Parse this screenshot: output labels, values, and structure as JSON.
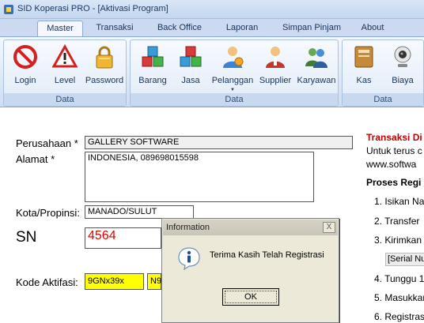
{
  "window": {
    "title": "SID Koperasi PRO - [Aktivasi Program]"
  },
  "tabs": [
    "Master",
    "Transaksi",
    "Back Office",
    "Laporan",
    "Simpan Pinjam",
    "About"
  ],
  "active_tab": "Master",
  "ribbon": {
    "groups": [
      {
        "caption": "Data",
        "buttons": [
          "Login",
          "Level",
          "Password"
        ]
      },
      {
        "caption": "Data",
        "buttons": [
          "Barang",
          "Jasa",
          "Pelanggan",
          "Supplier",
          "Karyawan"
        ]
      },
      {
        "caption": "Data",
        "buttons": [
          "Kas",
          "Biaya"
        ]
      }
    ]
  },
  "form": {
    "perusahaan_label": "Perusahaan *",
    "perusahaan_value": "GALLERY SOFTWARE",
    "alamat_label": "Alamat *",
    "alamat_value": "INDONESIA, 089698015598",
    "kota_label": "Kota/Propinsi:",
    "kota_value": "MANADO/SULUT",
    "sn_label": "SN",
    "sn_value": "4564",
    "kode_label": "Kode Aktifasi:",
    "kode_value_1": "9GNx39x",
    "kode_value_2": "N9"
  },
  "info_panel": {
    "title": "Transaksi Di",
    "line1": "Untuk terus c",
    "line2": "www.softwa",
    "proses": "Proses Regi",
    "steps": [
      "1. Isikan Na",
      "2. Transfer",
      "3. Kirimkan s",
      "4. Tunggu 1",
      "5. Masukkar",
      "6. Registras"
    ],
    "serial": "[Serial Nu"
  },
  "dialog": {
    "title": "Information",
    "message": "Terima Kasih Telah Registrasi",
    "ok_label": "OK",
    "close_glyph": "X"
  },
  "colors": {
    "accent_red": "#c00000",
    "sn_red": "#e00000",
    "highlight_yellow": "#ffff00",
    "ribbon_blue": "#cbdaf0"
  }
}
